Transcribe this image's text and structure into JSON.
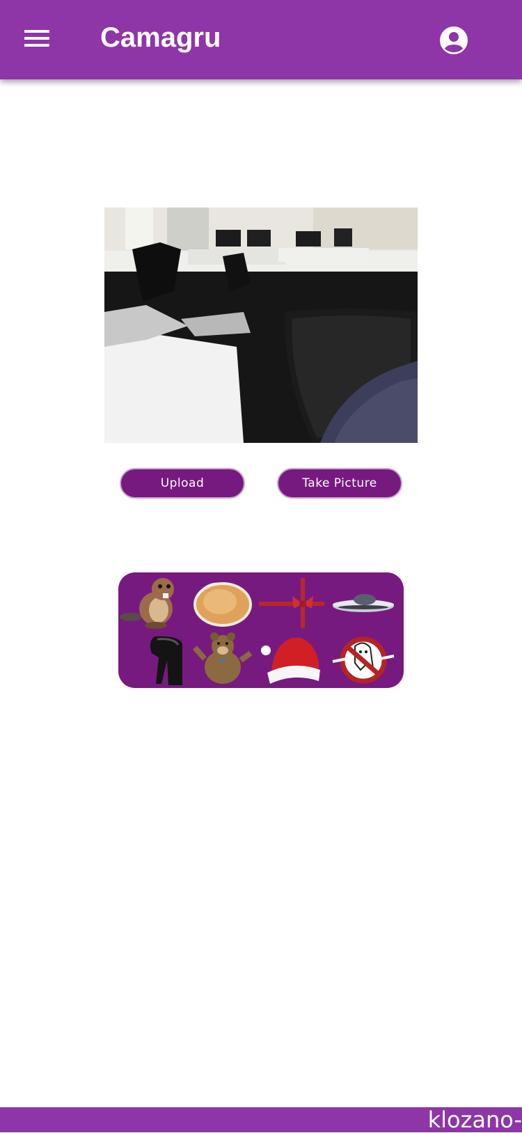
{
  "app": {
    "title": "Camagru"
  },
  "header": {
    "menu_icon": "hamburger-menu-icon",
    "account_icon": "account-circle-icon"
  },
  "camera": {
    "content": "webcam-preview"
  },
  "buttons": {
    "upload": "Upload",
    "take_picture": "Take Picture"
  },
  "stickers": {
    "items": [
      "beaver",
      "onion",
      "ribbon",
      "ufo",
      "alien",
      "bear",
      "santa-hat",
      "ghostbusters-logo"
    ]
  },
  "footer": {
    "text": "klozano-"
  },
  "colors": {
    "primary": "#8e35a8",
    "button": "#771a80",
    "button_border": "#c9a4d2"
  }
}
